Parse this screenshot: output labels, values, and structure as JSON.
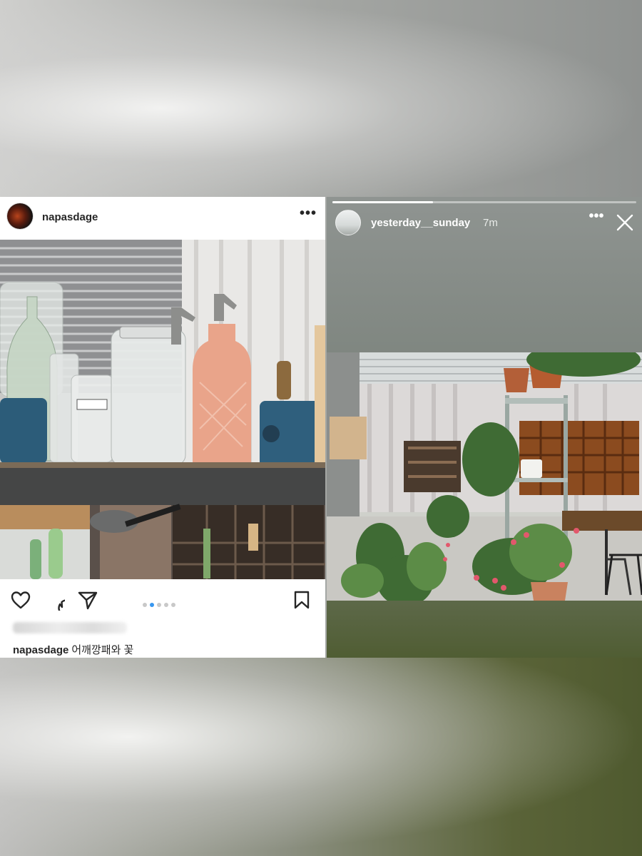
{
  "post": {
    "username": "napasdage",
    "more_icon": "more-horizontal-icon",
    "photo_alt_subject": "glass bottles on shelf",
    "actions": {
      "like_icon": "heart-icon",
      "comment_icon": "comment-bubble-icon",
      "share_icon": "paper-plane-icon",
      "save_icon": "bookmark-icon"
    },
    "carousel": {
      "count": 5,
      "active_index": 1
    },
    "caption_username": "napasdage",
    "caption_text": "어깨깡패와 꽃"
  },
  "story": {
    "username": "yesterday__sunday",
    "time": "7m",
    "progress": 0.33,
    "more_icon": "more-horizontal-icon",
    "close_icon": "close-icon"
  },
  "colors": {
    "ig_blue": "#3897f0",
    "text": "#262626",
    "story_bg_top": "#8f9491",
    "story_bg_bottom": "#505d33"
  }
}
